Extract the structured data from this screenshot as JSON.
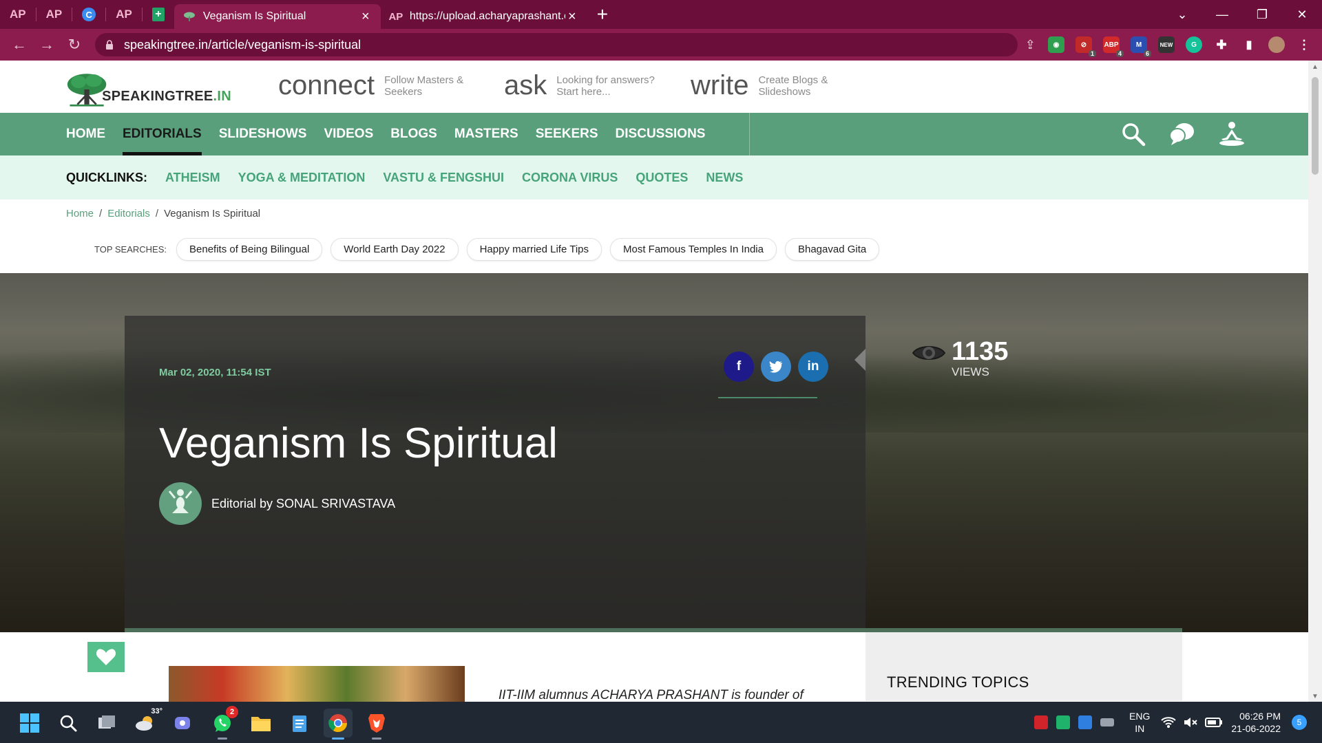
{
  "browser": {
    "pinned_tabs": [
      "AP",
      "AP",
      "C",
      "AP",
      "+"
    ],
    "tabs": [
      {
        "title": "Veganism Is Spiritual",
        "active": true
      },
      {
        "icon": "AP",
        "title": "https://upload.acharyaprashant.o",
        "active": false
      }
    ],
    "url": "speakingtree.in/article/veganism-is-spiritual",
    "extension_badges": {
      "adblock": "1",
      "abp": "4",
      "ext3": "6",
      "new": "NEW"
    }
  },
  "site": {
    "logo_text": "SPEAKINGTREE",
    "logo_suffix": ".IN",
    "header": [
      {
        "word": "connect",
        "sub1": "Follow Masters &",
        "sub2": "Seekers"
      },
      {
        "word": "ask",
        "sub1": "Looking for answers?",
        "sub2": "Start here..."
      },
      {
        "word": "write",
        "sub1": "Create Blogs &",
        "sub2": "Slideshows"
      }
    ],
    "nav": [
      "HOME",
      "EDITORIALS",
      "SLIDESHOWS",
      "VIDEOS",
      "BLOGS",
      "MASTERS",
      "SEEKERS",
      "DISCUSSIONS"
    ],
    "quicklinks_label": "QUICKLINKS:",
    "quicklinks": [
      "ATHEISM",
      "YOGA & MEDITATION",
      "VASTU & FENGSHUI",
      "CORONA VIRUS",
      "QUOTES",
      "NEWS"
    ],
    "breadcrumb": {
      "home": "Home",
      "section": "Editorials",
      "current": "Veganism Is Spiritual"
    },
    "top_searches_label": "TOP SEARCHES:",
    "top_searches": [
      "Benefits of Being Bilingual",
      "World Earth Day 2022",
      "Happy married Life Tips",
      "Most Famous Temples In India",
      "Bhagavad Gita"
    ]
  },
  "article": {
    "date": "Mar 02, 2020, 11:54 IST",
    "title": "Veganism Is Spiritual",
    "byline": "Editorial by SONAL SRIVASTAVA",
    "views": "1135",
    "views_label": "VIEWS",
    "lead": "IIT-IIM alumnus ACHARYA PRASHANT is founder of",
    "share": [
      "f",
      "t",
      "in"
    ]
  },
  "sidebar": {
    "trending_title": "TRENDING TOPICS"
  },
  "taskbar": {
    "weather": "33°",
    "whatsapp_badge": "2",
    "lang1": "ENG",
    "lang2": "IN",
    "time": "06:26 PM",
    "date": "21-06-2022",
    "notifications": "5"
  },
  "colors": {
    "browser_frame": "#6b0f3a",
    "toolbar": "#8c1c4d",
    "nav_green": "#5a9f7c",
    "quicklink_bg": "#e4f7ee",
    "link_green": "#46a37a"
  }
}
